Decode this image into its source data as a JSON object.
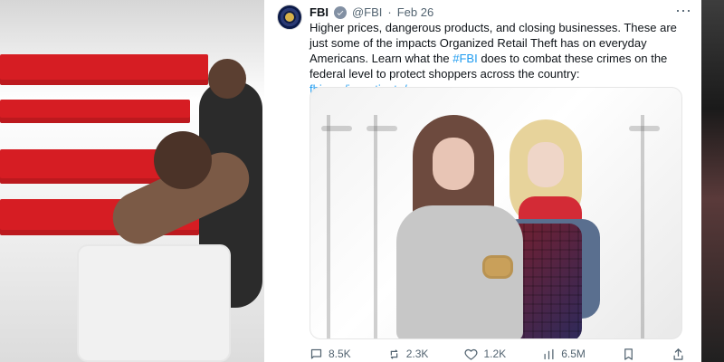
{
  "tweet": {
    "author_name": "FBI",
    "author_handle": "@FBI",
    "separator": "·",
    "date": "Feb 26",
    "text_part1": "Higher prices, dangerous products, and closing businesses. These are just some of the impacts Organized Retail Theft has on everyday Americans. Learn what the ",
    "hashtag": "#FBI",
    "text_part2": " does to combat these crimes on the federal level to protect shoppers across the country: ",
    "link": "fbi.gov/investigate/or…",
    "stats": {
      "replies": "8.5K",
      "reposts": "2.3K",
      "likes": "1.2K",
      "views": "6.5M"
    }
  },
  "colors": {
    "link": "#1d9bf0",
    "muted": "#536471",
    "text": "#0f1419"
  },
  "icons": {
    "more": "more-icon",
    "verified": "verified-icon",
    "reply": "reply-icon",
    "repost": "repost-icon",
    "like": "like-icon",
    "views": "views-icon",
    "bookmark": "bookmark-icon",
    "share": "share-icon"
  }
}
